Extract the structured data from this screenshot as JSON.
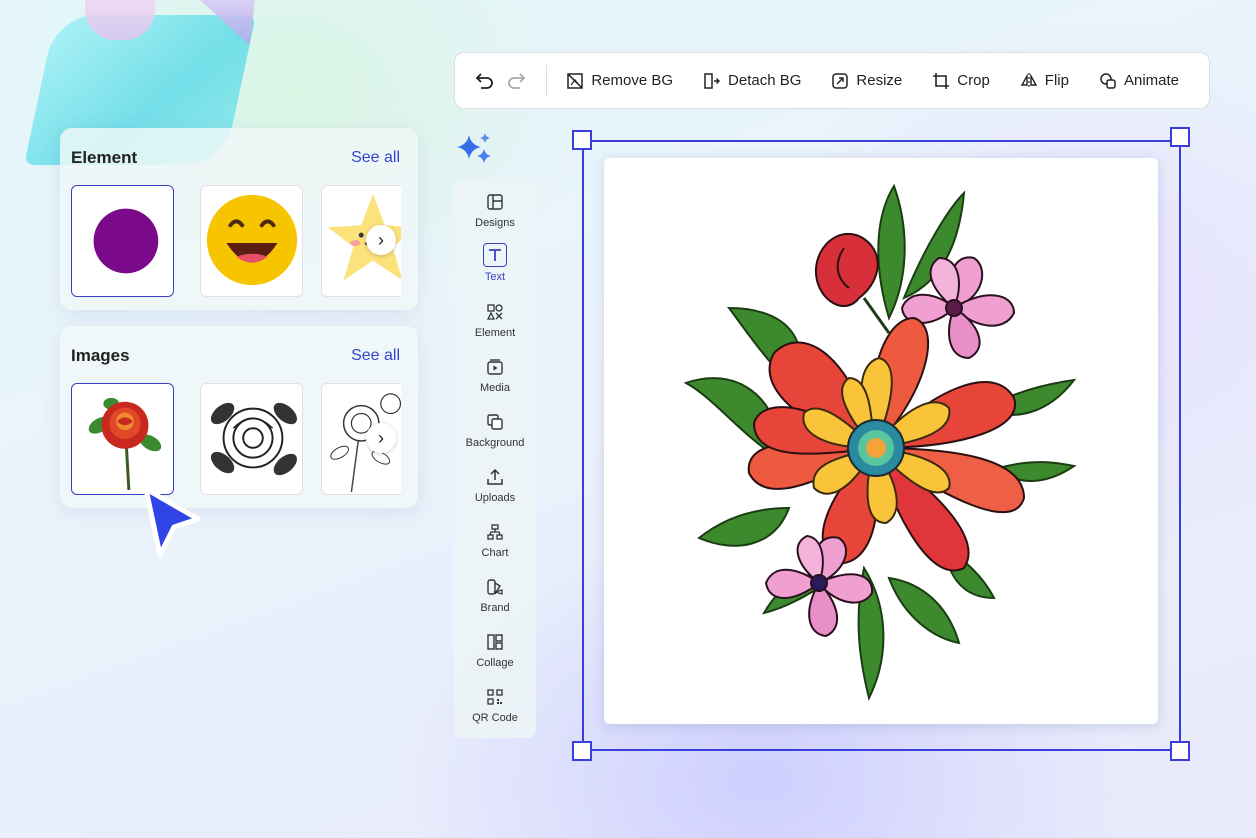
{
  "toolbar": {
    "actions": [
      {
        "label": "Remove BG",
        "icon": "remove-bg-icon"
      },
      {
        "label": "Detach BG",
        "icon": "detach-bg-icon"
      },
      {
        "label": "Resize",
        "icon": "resize-icon"
      },
      {
        "label": "Crop",
        "icon": "crop-icon"
      },
      {
        "label": "Flip",
        "icon": "flip-icon"
      },
      {
        "label": "Animate",
        "icon": "animate-icon"
      }
    ]
  },
  "elements_panel": {
    "title": "Element",
    "see_all": "See all"
  },
  "images_panel": {
    "title": "Images",
    "see_all": "See all"
  },
  "sidebar": {
    "items": [
      {
        "label": "Designs",
        "icon": "designs-icon"
      },
      {
        "label": "Text",
        "icon": "text-icon"
      },
      {
        "label": "Element",
        "icon": "element-icon"
      },
      {
        "label": "Media",
        "icon": "media-icon"
      },
      {
        "label": "Background",
        "icon": "background-icon"
      },
      {
        "label": "Uploads",
        "icon": "upload-icon"
      },
      {
        "label": "Chart",
        "icon": "chart-icon"
      },
      {
        "label": "Brand",
        "icon": "brand-icon"
      },
      {
        "label": "Collage",
        "icon": "collage-icon"
      },
      {
        "label": "QR Code",
        "icon": "qr-code-icon"
      }
    ],
    "active": "Text"
  },
  "colors": {
    "accent": "#3a3fc4",
    "selection": "#3a3fd8",
    "cursor": "#2f45e8"
  }
}
